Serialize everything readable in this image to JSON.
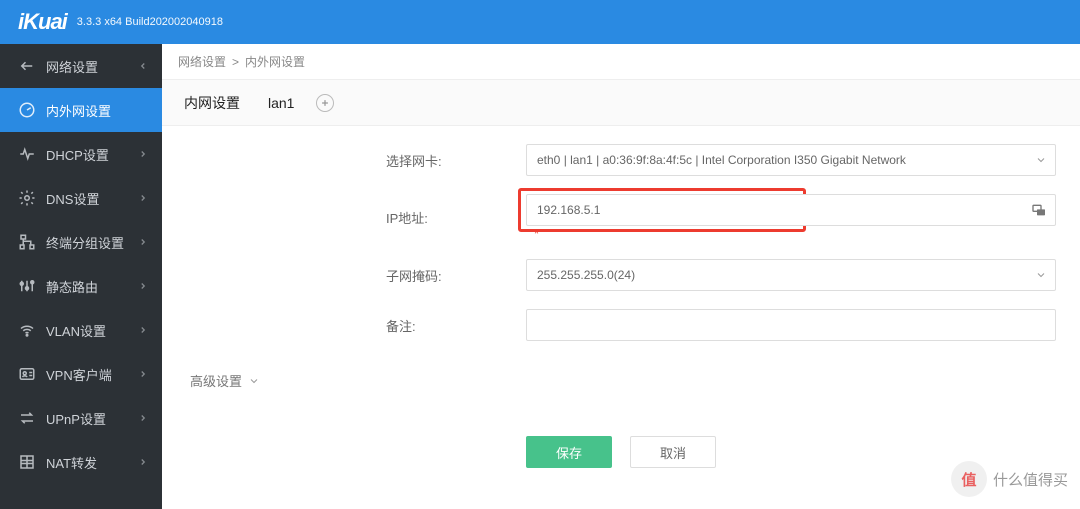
{
  "header": {
    "logo": "iKuai",
    "build": "3.3.3 x64 Build202002040918"
  },
  "sidebar": {
    "items": [
      {
        "label": "网络设置"
      },
      {
        "label": "内外网设置"
      },
      {
        "label": "DHCP设置"
      },
      {
        "label": "DNS设置"
      },
      {
        "label": "终端分组设置"
      },
      {
        "label": "静态路由"
      },
      {
        "label": "VLAN设置"
      },
      {
        "label": "VPN客户端"
      },
      {
        "label": "UPnP设置"
      },
      {
        "label": "NAT转发"
      }
    ],
    "activeIndex": 1
  },
  "breadcrumb": {
    "a": "网络设置",
    "b": "内外网设置"
  },
  "tabs": {
    "current": "内网设置",
    "iface": "lan1"
  },
  "form": {
    "nic_label": "选择网卡:",
    "nic_value": "eth0 | lan1 | a0:36:9f:8a:4f:5c | Intel Corporation I350 Gigabit Network",
    "ip_label": "IP地址:",
    "ip_value": "192.168.5.1",
    "mask_label": "子网掩码:",
    "mask_value": "255.255.255.0(24)",
    "note_label": "备注:",
    "note_value": ""
  },
  "advanced_label": "高级设置",
  "buttons": {
    "save": "保存",
    "cancel": "取消"
  },
  "watermark": {
    "symbol": "值",
    "text": "什么值得买"
  }
}
